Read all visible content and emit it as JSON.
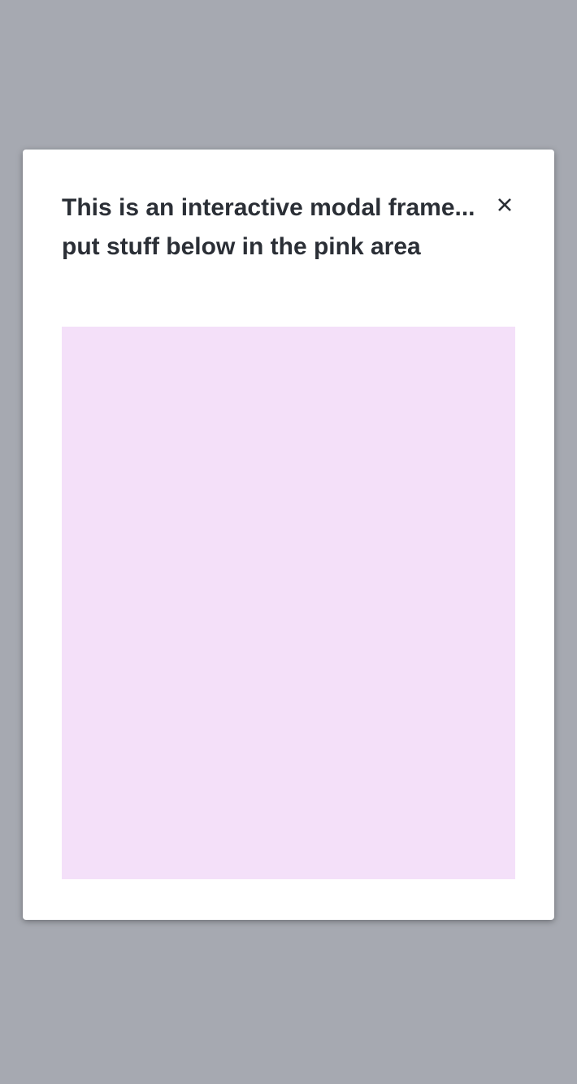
{
  "modal": {
    "title": "This is an interactive modal frame... put stuff below in the pink area",
    "close_icon": "close-x-icon",
    "content_color": "#f4e0f9"
  },
  "colors": {
    "backdrop": "#a6a9b1",
    "modal": "#ffffff",
    "text": "#2b2f36"
  }
}
